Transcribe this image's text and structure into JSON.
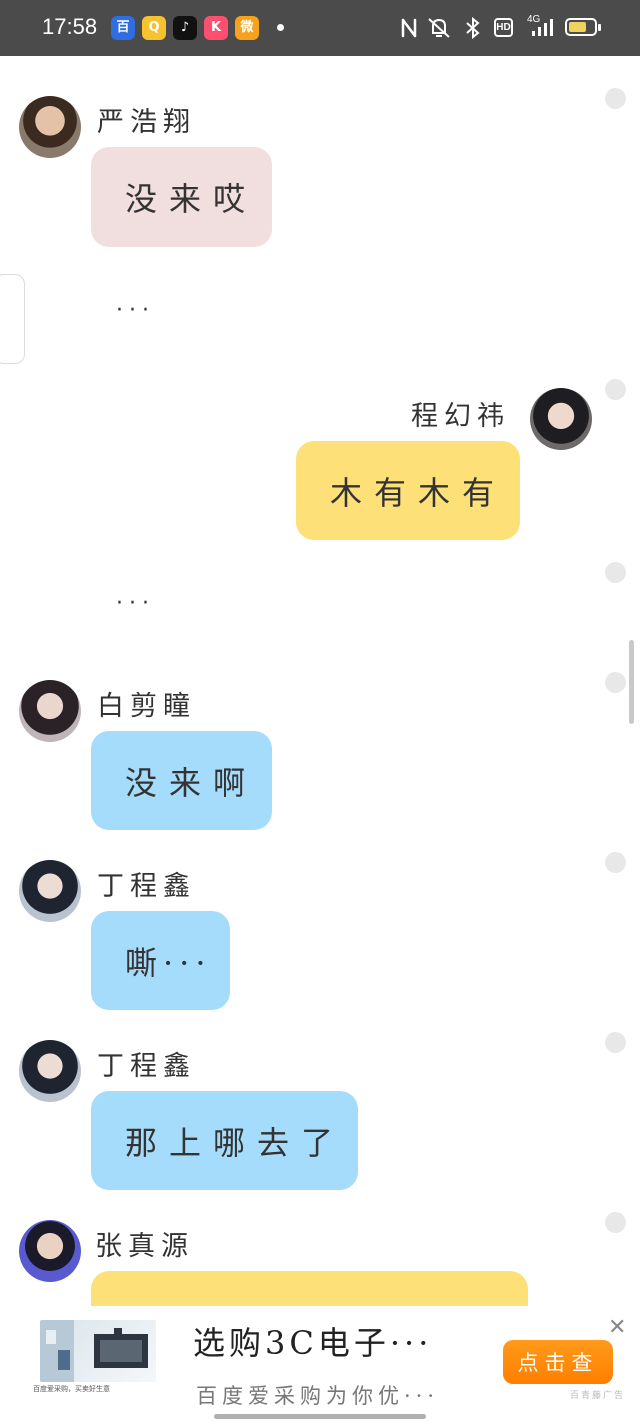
{
  "status_bar": {
    "time": "17:58",
    "network": "4G",
    "hd": "HD",
    "battery_level": 0.7,
    "app_icons": [
      {
        "name": "baidu-app-icon",
        "color": "#2f6de0",
        "glyph": "百"
      },
      {
        "name": "qq-browser-app-icon",
        "color": "#f6c32f",
        "glyph": "Q"
      },
      {
        "name": "douyin-app-icon",
        "color": "#111111",
        "glyph": "♪"
      },
      {
        "name": "kuaishou-app-icon",
        "color": "#ff4f6e",
        "glyph": "K"
      },
      {
        "name": "weibo-app-icon",
        "color": "#f7a21b",
        "glyph": "微"
      }
    ]
  },
  "messages": [
    {
      "sender": "严浩翔",
      "text": "没来哎",
      "side": "left",
      "bubble_color": "#f1dede"
    },
    {
      "text": "···"
    },
    {
      "sender": "程幻祎",
      "text": "木有木有",
      "side": "right",
      "bubble_color": "#fde178"
    },
    {
      "text": "···"
    },
    {
      "sender": "白剪瞳",
      "text": "没来啊",
      "side": "left",
      "bubble_color": "#a6dcfb"
    },
    {
      "sender": "丁程鑫",
      "text": "嘶···",
      "side": "left",
      "bubble_color": "#a6dcfb"
    },
    {
      "sender": "丁程鑫",
      "text": "那上哪去了",
      "side": "left",
      "bubble_color": "#a6dcfb"
    },
    {
      "sender": "张真源",
      "text": "",
      "side": "left",
      "bubble_color": "#fde178"
    }
  ],
  "ad": {
    "image_caption": "百度爱采购，买卖好生意",
    "title": "选购3C电子···",
    "subtitle": "百度爱采购为你优···",
    "button_label": "点击查",
    "close_glyph": "✕",
    "ad_label": "百青藤广告"
  }
}
